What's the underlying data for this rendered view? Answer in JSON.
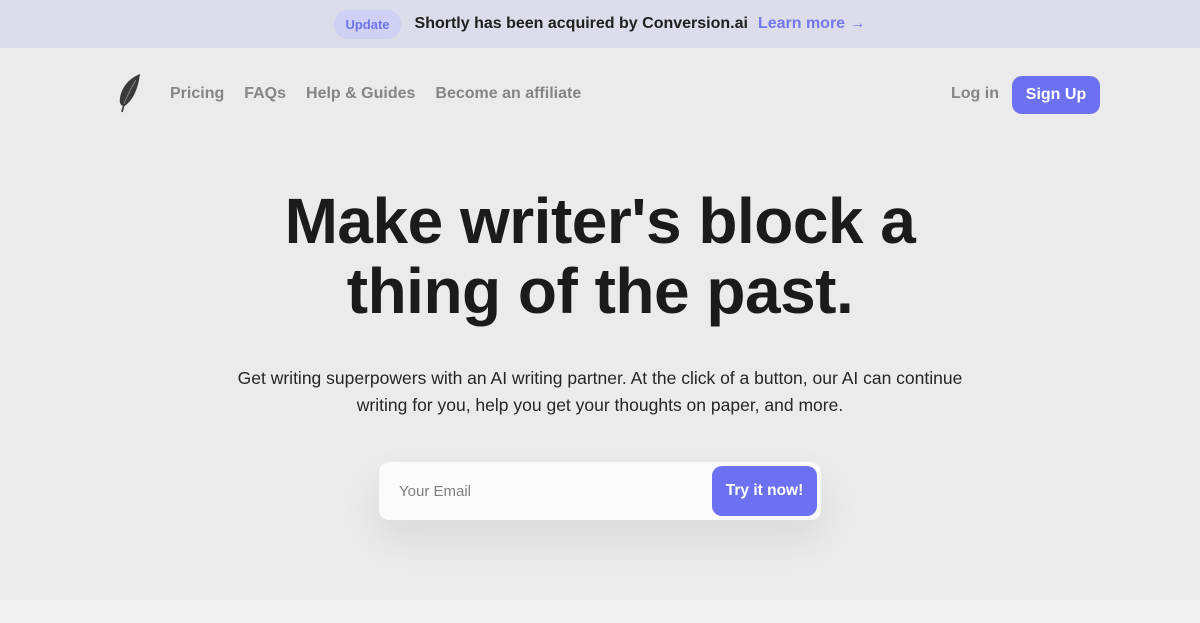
{
  "banner": {
    "badge": "Update",
    "message": "Shortly has been acquired by Conversion.ai",
    "link_label": "Learn more →"
  },
  "nav": {
    "logo_icon": "feather-icon",
    "links": [
      {
        "label": "Pricing"
      },
      {
        "label": "FAQs"
      },
      {
        "label": "Help & Guides"
      },
      {
        "label": "Become an affiliate"
      }
    ],
    "login_label": "Log in",
    "signup_label": "Sign Up"
  },
  "hero": {
    "title_line1": "Make writer's block a",
    "title_line2": "thing of the past.",
    "subtitle_line1": "Get writing superpowers with an AI writing partner. At the click of a button, our AI can continue",
    "subtitle_line2": "writing for you, help you get your thoughts on paper, and more."
  },
  "signup_form": {
    "email_placeholder": "Your Email",
    "email_value": "",
    "submit_label": "Try it now!"
  },
  "colors": {
    "accent": "#6b71f0",
    "banner_bg": "#dcdcea",
    "page_bg": "#ebebeb"
  }
}
